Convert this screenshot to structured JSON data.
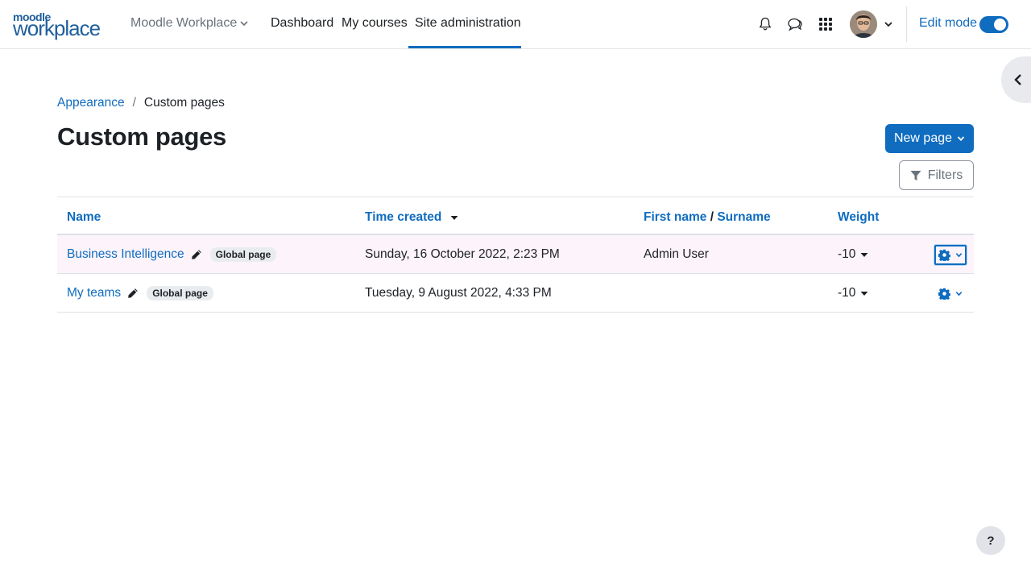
{
  "brand": {
    "line1": "moodle",
    "line2": "workplace"
  },
  "site_switcher": {
    "label": "Moodle Workplace"
  },
  "nav": {
    "items": [
      {
        "label": "Dashboard"
      },
      {
        "label": "My courses"
      },
      {
        "label": "Site administration"
      }
    ],
    "active": "Site administration"
  },
  "user_menu": {
    "edit_mode_label": "Edit mode",
    "edit_mode_on": true
  },
  "breadcrumb": {
    "parent": "Appearance",
    "separator": "/",
    "current": "Custom pages"
  },
  "page": {
    "title": "Custom pages"
  },
  "actions": {
    "new_page_label": "New page",
    "filters_label": "Filters"
  },
  "table": {
    "headers": {
      "name": "Name",
      "time_created": "Time created",
      "first_name": "First name",
      "name_separator": "/",
      "surname": "Surname",
      "weight": "Weight"
    },
    "rows": [
      {
        "name": "Business Intelligence",
        "badge": "Global page",
        "time_created": "Sunday, 16 October 2022, 2:23 PM",
        "user": "Admin User",
        "weight": "-10"
      },
      {
        "name": "My teams",
        "badge": "Global page",
        "time_created": "Tuesday, 9 August 2022, 4:33 PM",
        "user": "",
        "weight": "-10"
      }
    ]
  },
  "help": {
    "label": "?"
  },
  "colors": {
    "primary": "#0f6cbf",
    "row_highlight": "#fdf4fb",
    "text": "#1d2125",
    "muted": "#6a737b"
  }
}
